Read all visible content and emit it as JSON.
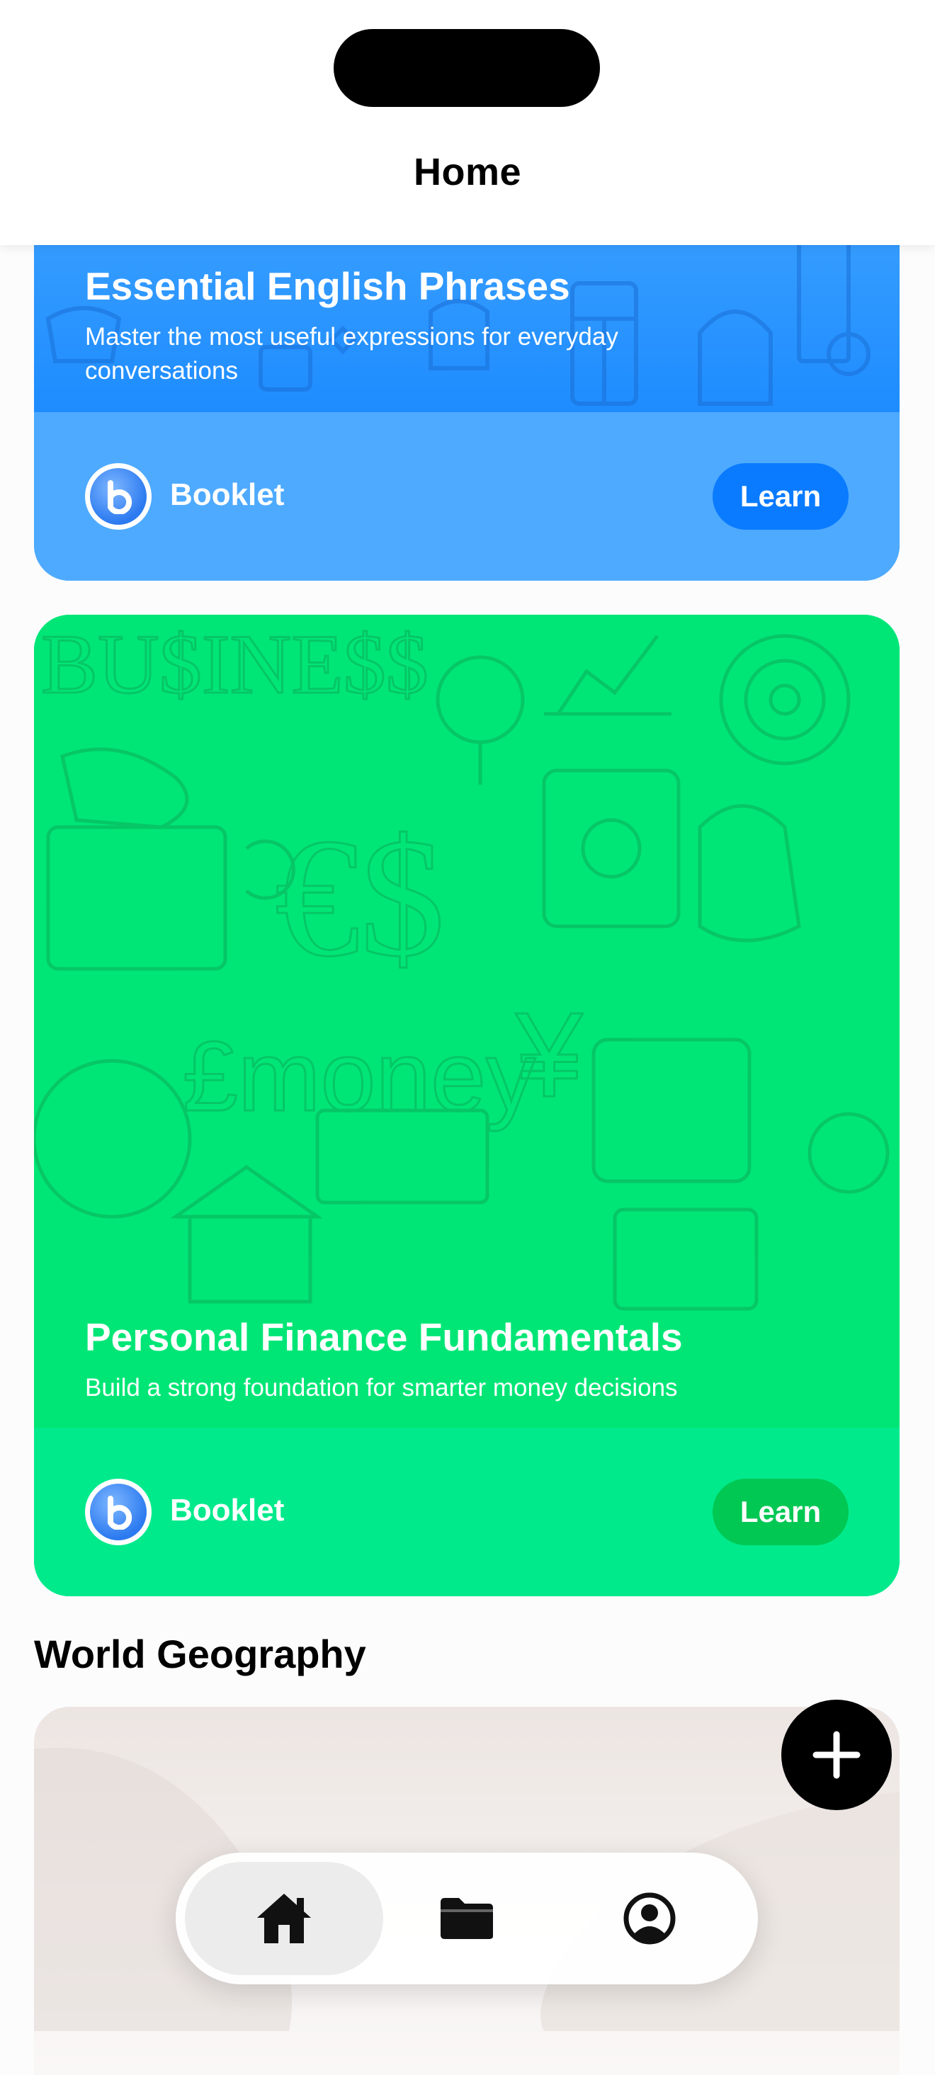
{
  "header": {
    "title": "Home"
  },
  "cards": [
    {
      "title": "Essential English Phrases",
      "description": "Master the most useful expressions for everyday conversations",
      "source_label": "Booklet",
      "action_label": "Learn",
      "colors": {
        "art": "#2f9bff",
        "footer": "#4eaaff",
        "button": "#0a7bff"
      }
    },
    {
      "title": "Personal Finance Fundamentals",
      "description": "Build a strong foundation for smarter money decisions",
      "source_label": "Booklet",
      "action_label": "Learn",
      "colors": {
        "art": "#00e676",
        "footer": "#00ea8c",
        "button": "#00c853"
      }
    }
  ],
  "sections": [
    {
      "title": "World Geography"
    }
  ],
  "fab": {
    "icon": "plus-icon"
  },
  "tabbar": {
    "items": [
      {
        "icon": "home-icon",
        "active": true
      },
      {
        "icon": "folder-icon",
        "active": false
      },
      {
        "icon": "account-icon",
        "active": false
      }
    ]
  }
}
